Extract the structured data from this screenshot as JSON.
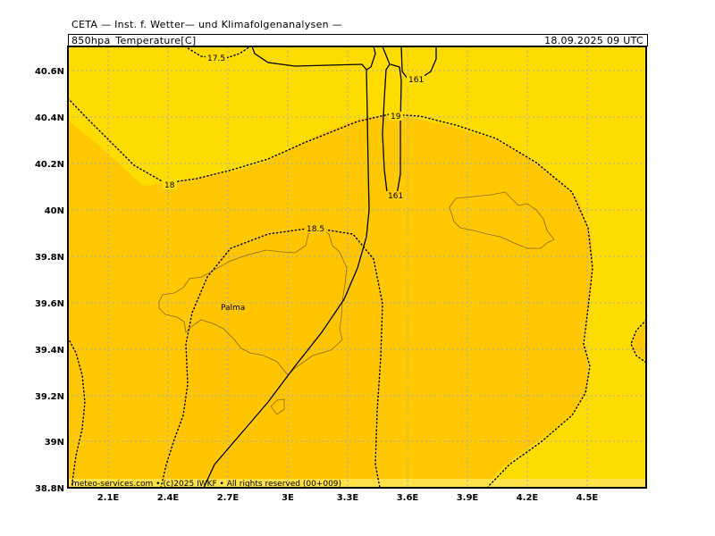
{
  "header": {
    "title": "CETA — Inst. f. Wetter— und Klimafolgenanalysen —",
    "parameter": "850hpa_Temperature[C]",
    "valid_time": "18.09.2025 09 UTC"
  },
  "map": {
    "lat_ticks": [
      "40.6N",
      "40.4N",
      "40.2N",
      "40N",
      "39.8N",
      "39.6N",
      "39.4N",
      "39.2N",
      "39N",
      "38.8N"
    ],
    "lon_ticks": [
      "2.1E",
      "2.4E",
      "2.7E",
      "3E",
      "3.3E",
      "3.6E",
      "3.9E",
      "4.2E",
      "4.5E"
    ],
    "city_label": "Palma",
    "contour_labels": [
      "17.5",
      "18",
      "18.5",
      "19",
      "161",
      "161"
    ],
    "colors": {
      "warm_zone": "#FFC800",
      "mid_zone": "#FFD500",
      "cool_zone": "#FFDC00",
      "grid": "#aaaaaa",
      "coast": "#8a6a1a"
    }
  },
  "footer": {
    "credit": "meteo-services.com • (c)2025 IWKF • All rights reserved (00+009)"
  }
}
